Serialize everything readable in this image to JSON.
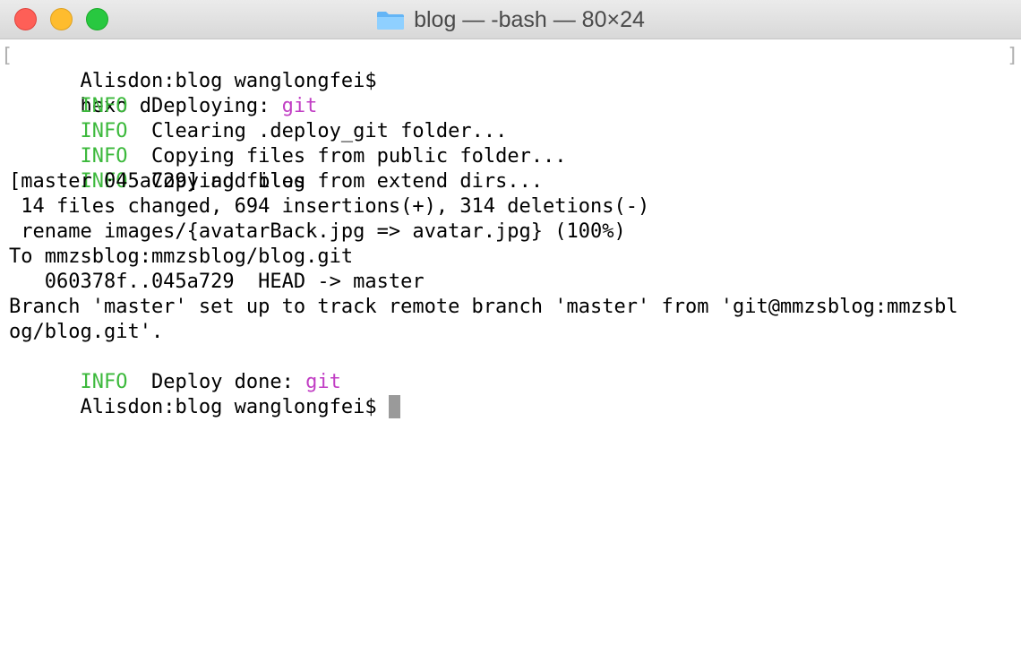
{
  "window": {
    "title": "blog — -bash — 80×24"
  },
  "colors": {
    "info": "#3cb93c",
    "git": "#c13ec4",
    "cursor": "#9a9a9a"
  },
  "terminal": {
    "prompt": "Alisdon:blog wanglongfei$",
    "command": "hexo d",
    "lines": [
      {
        "tag": "INFO",
        "text": "Deploying: ",
        "highlight": "git"
      },
      {
        "tag": "INFO",
        "text": "Clearing .deploy_git folder..."
      },
      {
        "tag": "INFO",
        "text": "Copying files from public folder..."
      },
      {
        "tag": "INFO",
        "text": "Copying files from extend dirs..."
      },
      {
        "text": "[master 045a729] add blog"
      },
      {
        "text": " 14 files changed, 694 insertions(+), 314 deletions(-)"
      },
      {
        "text": " rename images/{avatarBack.jpg => avatar.jpg} (100%)"
      },
      {
        "text": "To mmzsblog:mmzsblog/blog.git"
      },
      {
        "text": "   060378f..045a729  HEAD -> master"
      },
      {
        "text": "Branch 'master' set up to track remote branch 'master' from 'git@mmzsblog:mmzsbl"
      },
      {
        "text": "og/blog.git'."
      },
      {
        "tag": "INFO",
        "text": "Deploy done: ",
        "highlight": "git"
      }
    ],
    "final_prompt": "Alisdon:blog wanglongfei$"
  }
}
